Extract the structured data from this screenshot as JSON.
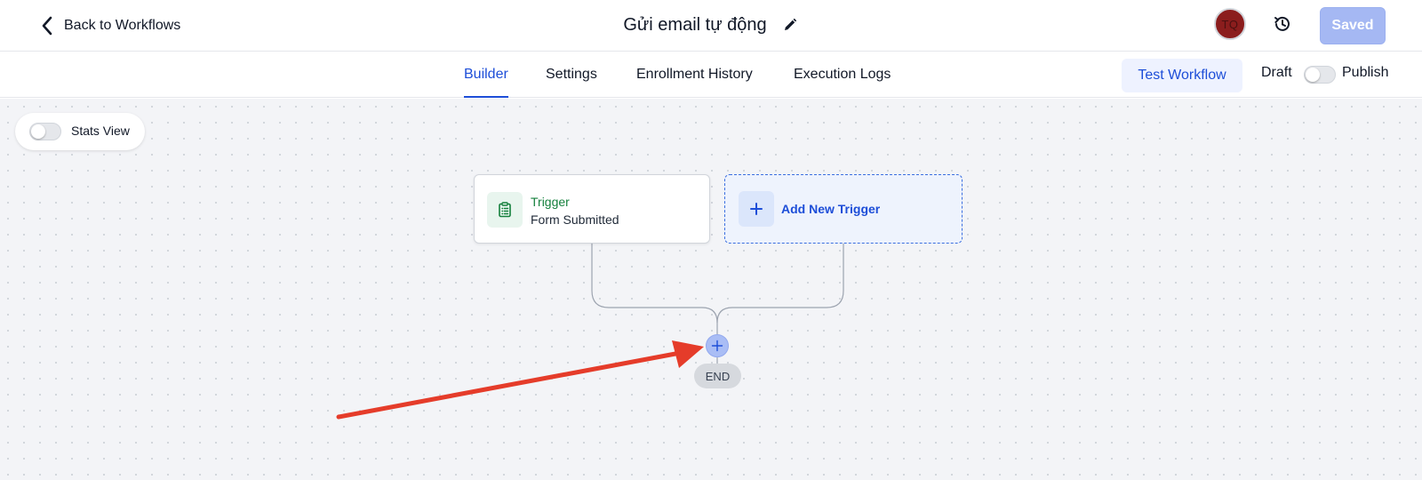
{
  "header": {
    "back_label": "Back to Workflows",
    "title": "Gửi email tự động",
    "avatar_initials": "TQ",
    "saved_label": "Saved"
  },
  "tabs": [
    {
      "label": "Builder",
      "active": true
    },
    {
      "label": "Settings",
      "active": false
    },
    {
      "label": "Enrollment History",
      "active": false
    },
    {
      "label": "Execution Logs",
      "active": false
    }
  ],
  "actions": {
    "test_workflow_label": "Test Workflow",
    "draft_label": "Draft",
    "publish_label": "Publish",
    "publish_toggle_on": false
  },
  "canvas": {
    "stats_view_label": "Stats View",
    "stats_view_on": false,
    "trigger": {
      "title": "Trigger",
      "subtitle": "Form Submitted"
    },
    "add_trigger_label": "Add New Trigger",
    "end_label": "END"
  },
  "colors": {
    "accent": "#1d4ed8",
    "trigger_green": "#15803d",
    "annotation_arrow": "#e53c2a",
    "saved_button": "#a5b8f3"
  },
  "icons": {
    "back": "chevron-left-icon",
    "edit": "pencil-icon",
    "history": "history-clock-icon",
    "trigger": "clipboard-list-icon",
    "add": "plus-icon"
  }
}
